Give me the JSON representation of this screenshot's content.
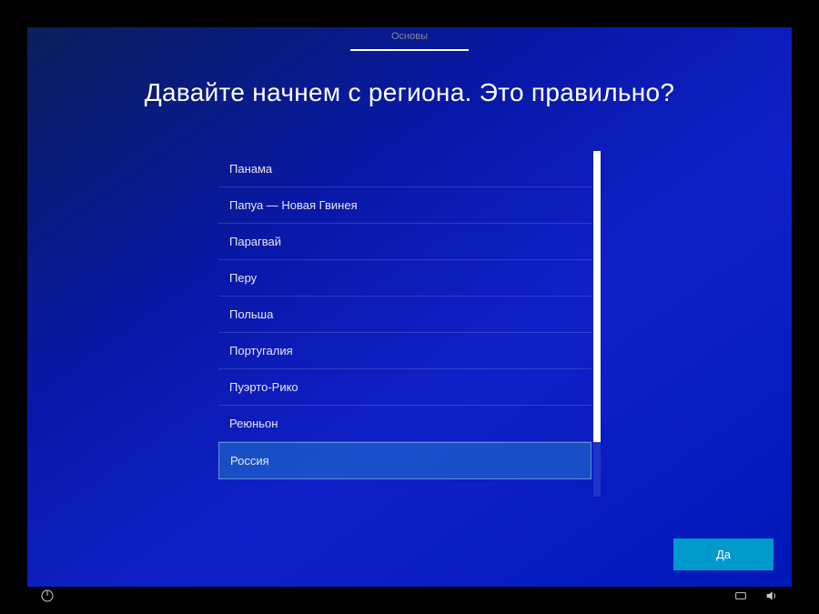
{
  "tabs": {
    "active": "Основы"
  },
  "title": "Давайте начнем с региона. Это правильно?",
  "regions": {
    "items": [
      "Панама",
      "Папуа — Новая Гвинея",
      "Парагвай",
      "Перу",
      "Польша",
      "Португалия",
      "Пуэрто-Рико",
      "Реюньон",
      "Россия"
    ],
    "selected_index": 8
  },
  "buttons": {
    "yes": "Да"
  }
}
